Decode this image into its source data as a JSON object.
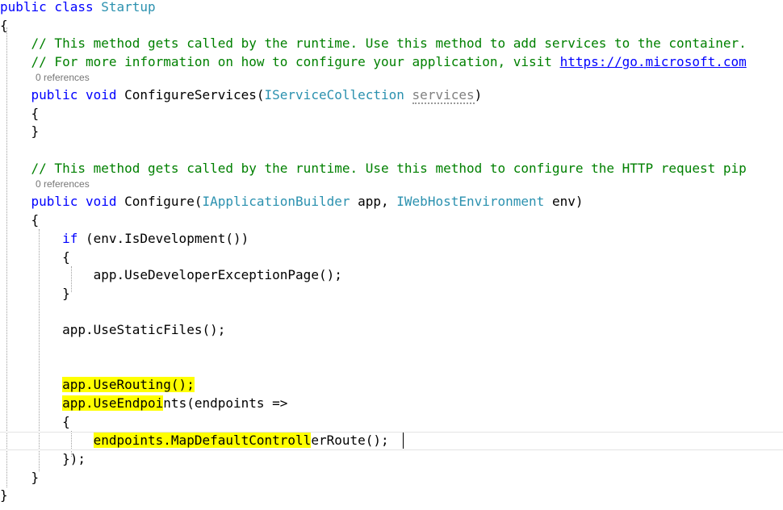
{
  "editor": {
    "lines": [
      {
        "segments": [
          {
            "t": "public class ",
            "c": "kw"
          },
          {
            "t": "Startup",
            "c": "type"
          }
        ]
      },
      {
        "segments": [
          {
            "t": "{",
            "c": ""
          }
        ]
      },
      {
        "segments": [
          {
            "t": "    // This method gets called by the runtime. Use this method to add services to the container.",
            "c": "cm"
          }
        ]
      },
      {
        "segments": [
          {
            "t": "    // For more information on how to configure your application, visit ",
            "c": "cm"
          },
          {
            "t": "https://go.microsoft.com",
            "c": "link"
          }
        ]
      },
      {
        "segments": [
          {
            "t": "    ",
            "c": ""
          },
          {
            "t": "public void ",
            "c": "kw"
          },
          {
            "t": "ConfigureServices(",
            "c": ""
          },
          {
            "t": "IServiceCollection",
            "c": "type"
          },
          {
            "t": " ",
            "c": ""
          },
          {
            "t": "services",
            "c": "faded squiggle"
          },
          {
            "t": ")",
            "c": ""
          }
        ]
      },
      {
        "segments": [
          {
            "t": "    {",
            "c": ""
          }
        ]
      },
      {
        "segments": [
          {
            "t": "    }",
            "c": ""
          }
        ]
      },
      {
        "segments": [
          {
            "t": "    // This method gets called by the runtime. Use this method to configure the HTTP request pip",
            "c": "cm"
          }
        ]
      },
      {
        "segments": [
          {
            "t": "    ",
            "c": ""
          },
          {
            "t": "public void ",
            "c": "kw"
          },
          {
            "t": "Configure(",
            "c": ""
          },
          {
            "t": "IApplicationBuilder",
            "c": "type"
          },
          {
            "t": " app, ",
            "c": ""
          },
          {
            "t": "IWebHostEnvironment",
            "c": "type"
          },
          {
            "t": " env)",
            "c": ""
          }
        ]
      },
      {
        "segments": [
          {
            "t": "    {",
            "c": ""
          }
        ]
      },
      {
        "segments": [
          {
            "t": "        ",
            "c": ""
          },
          {
            "t": "if",
            "c": "kw"
          },
          {
            "t": " (env.IsDevelopment())",
            "c": ""
          }
        ]
      },
      {
        "segments": [
          {
            "t": "        {",
            "c": ""
          }
        ]
      },
      {
        "segments": [
          {
            "t": "            app.UseDeveloperExceptionPage();",
            "c": ""
          }
        ]
      },
      {
        "segments": [
          {
            "t": "        }",
            "c": ""
          }
        ]
      },
      {
        "segments": [
          {
            "t": "        app.UseStaticFiles();",
            "c": ""
          }
        ]
      },
      {
        "segments": [
          {
            "t": "        ",
            "c": ""
          },
          {
            "t": "app.UseRouting();",
            "c": "hl"
          }
        ]
      },
      {
        "segments": [
          {
            "t": "        ",
            "c": ""
          },
          {
            "t": "app.UseEndpoi",
            "c": "hl"
          },
          {
            "t": "nts(endpoints =>",
            "c": ""
          }
        ]
      },
      {
        "segments": [
          {
            "t": "        {",
            "c": ""
          }
        ]
      },
      {
        "segments": [
          {
            "t": "            ",
            "c": ""
          },
          {
            "t": "endpoints.MapDefaultControll",
            "c": "hl"
          },
          {
            "t": "erRoute();",
            "c": ""
          }
        ]
      },
      {
        "segments": [
          {
            "t": "        });",
            "c": ""
          }
        ]
      },
      {
        "segments": [
          {
            "t": "    }",
            "c": ""
          }
        ]
      },
      {
        "segments": [
          {
            "t": "}",
            "c": ""
          }
        ]
      }
    ],
    "codelens": [
      {
        "text": "0 references"
      },
      {
        "text": "0 references"
      }
    ]
  }
}
